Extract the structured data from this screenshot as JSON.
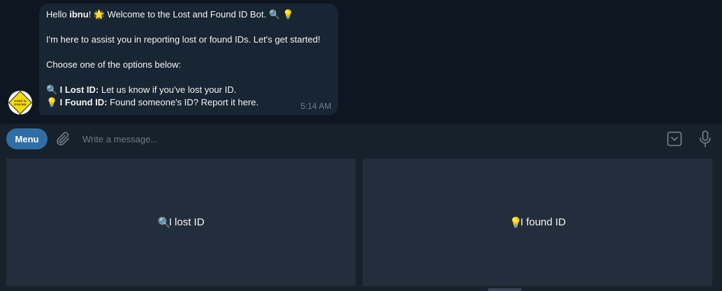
{
  "message": {
    "greeting_prefix": "Hello ",
    "username": "ibnu",
    "greeting_suffix": "! ",
    "star_emoji": "🌟",
    "welcome_text": " Welcome to the Lost and Found ID Bot. ",
    "search_emoji": "🔍",
    "bulb_emoji": "💡",
    "intro_text": "I'm here to assist you in reporting lost or found IDs. Let's get started!",
    "choose_text": "Choose one of the options below:",
    "options": [
      {
        "emoji": "🔍",
        "title": "I Lost ID:",
        "desc": " Let us know if you've lost your ID."
      },
      {
        "emoji": "💡",
        "title": "I Found ID:",
        "desc": " Found someone's ID? Report it here."
      }
    ],
    "time": "5:14 AM"
  },
  "avatar": {
    "logo_text": "LOST & FOUND"
  },
  "input_bar": {
    "menu_label": "Menu",
    "placeholder": "Write a message..."
  },
  "keyboard": {
    "buttons": [
      {
        "emoji": "🔍",
        "label": "I lost ID"
      },
      {
        "emoji": "💡",
        "label": "I found ID"
      }
    ]
  },
  "icons": {
    "attach": "paperclip-icon",
    "keyboard": "keyboard-toggle-icon",
    "mic": "microphone-icon"
  },
  "colors": {
    "background": "#0e1621",
    "bubble": "#182533",
    "panel": "#17212b",
    "keyboard_button": "#232e3c",
    "accent": "#2f6ea5",
    "timestamp": "#6d7f8f"
  }
}
